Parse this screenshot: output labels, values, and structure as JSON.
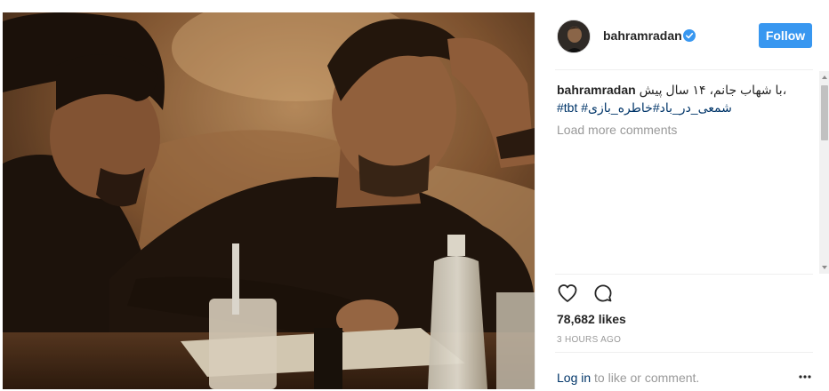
{
  "post": {
    "username": "bahramradan",
    "verified": true,
    "follow_label": "Follow",
    "caption_user": "bahramradan",
    "caption_text": "با شهاب جانم، ۱۴ سال پیش،",
    "caption_hashtags": [
      "#tbt",
      "#شمعی_در_باد",
      "#خاطره_بازی"
    ],
    "load_more_label": "Load more comments",
    "likes_label": "78,682 likes",
    "timestamp": "3 HOURS AGO",
    "login_link": "Log in",
    "login_suffix": " to like or comment."
  },
  "icons": {
    "verified": "verified-badge-icon",
    "like": "heart-icon",
    "comment": "comment-bubble-icon",
    "more": "more-options-icon"
  },
  "colors": {
    "follow_button": "#3897f0",
    "verified_badge": "#3897f0",
    "link": "#003569",
    "muted": "#999999"
  }
}
